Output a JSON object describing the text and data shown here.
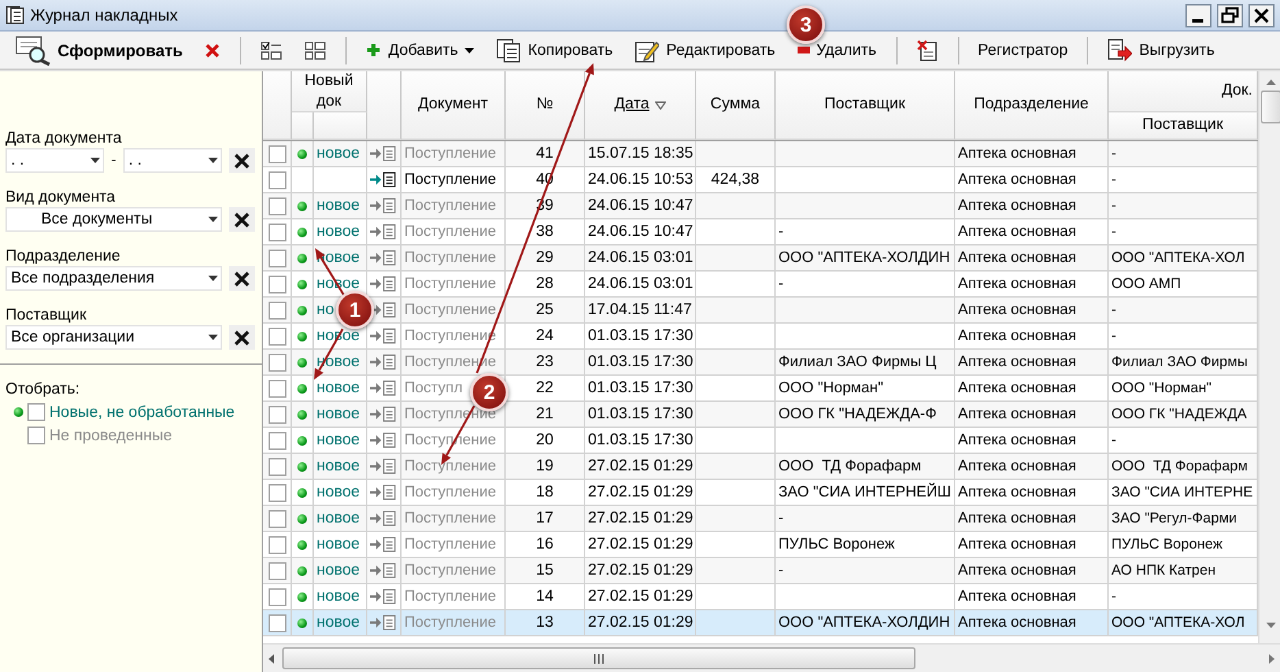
{
  "window": {
    "title": "Журнал накладных"
  },
  "toolbar": [
    {
      "kind": "primary",
      "label": "Сформировать"
    },
    {
      "kind": "icon"
    },
    {
      "kind": "separator"
    },
    {
      "kind": "icon"
    },
    {
      "kind": "icon"
    },
    {
      "kind": "separator"
    },
    {
      "kind": "menu",
      "label": "Добавить"
    },
    {
      "kind": "button",
      "label": "Копировать"
    },
    {
      "kind": "button",
      "label": "Редактировать"
    },
    {
      "kind": "button",
      "label": "Удалить"
    },
    {
      "kind": "separator"
    },
    {
      "kind": "icon"
    },
    {
      "kind": "separator"
    },
    {
      "kind": "button",
      "label": "Регистратор"
    },
    {
      "kind": "separator"
    },
    {
      "kind": "button",
      "label": "Выгрузить"
    }
  ],
  "sidebar": {
    "filters": [
      {
        "kind": "date_range",
        "label": "Дата документа",
        "values": [
          ". .",
          ". ."
        ],
        "separator": "-"
      },
      {
        "kind": "select",
        "label": "Вид документа",
        "value": "Все документы"
      },
      {
        "kind": "select",
        "label": "Подразделение",
        "value": "Все подразделения"
      },
      {
        "kind": "select",
        "label": "Поставщик",
        "value": "Все организации"
      }
    ],
    "show": {
      "label": "Отобрать:",
      "options": [
        {
          "kind": "new",
          "label": "Новые, не обработанные",
          "checked": false
        },
        {
          "kind": "unposted",
          "label": "Не проведенные",
          "checked": false
        }
      ]
    }
  },
  "table": {
    "columns": [
      {
        "label": "Новый док",
        "sorted": false
      },
      {
        "label": "Документ",
        "sorted": false
      },
      {
        "label": "№",
        "sorted": false
      },
      {
        "label": "Дата",
        "sorted": true
      },
      {
        "label": "Сумма",
        "sorted": false
      },
      {
        "label": "Поставщик",
        "sorted": false
      },
      {
        "label": "Подразделение",
        "sorted": false
      },
      {
        "label": "Док.",
        "sorted": false,
        "children": [
          {
            "label": "Поставщик"
          }
        ]
      }
    ],
    "rows": [
      {
        "checked": false,
        "new": true,
        "status": "новое",
        "posted": false,
        "document": "Поступление",
        "number": "41",
        "date": "15.07.15 18:35",
        "department": "Аптека основная",
        "doc_supplier": "-",
        "selected": false
      },
      {
        "checked": false,
        "new": false,
        "posted": true,
        "document": "Поступление",
        "number": "40",
        "date": "24.06.15 10:53",
        "sum": "424,38",
        "department": "Аптека основная",
        "doc_supplier": "-",
        "selected": false
      },
      {
        "checked": false,
        "new": true,
        "status": "новое",
        "posted": false,
        "document": "Поступление",
        "number": "39",
        "date": "24.06.15 10:47",
        "department": "Аптека основная",
        "doc_supplier": "-",
        "selected": false
      },
      {
        "checked": false,
        "new": true,
        "status": "новое",
        "posted": false,
        "document": "Поступление",
        "number": "38",
        "date": "24.06.15 10:47",
        "supplier": "-",
        "department": "Аптека основная",
        "doc_supplier": "-",
        "selected": false
      },
      {
        "checked": false,
        "new": true,
        "status": "новое",
        "posted": false,
        "document": "Поступление",
        "number": "29",
        "date": "24.06.15 03:01",
        "supplier": "ООО \"АПТЕКА-ХОЛДИН",
        "department": "Аптека основная",
        "doc_supplier": "ООО \"АПТЕКА-ХОЛ",
        "selected": false
      },
      {
        "checked": false,
        "new": true,
        "status": "новое",
        "posted": false,
        "document": "Поступление",
        "number": "28",
        "date": "24.06.15 03:01",
        "supplier": "-",
        "department": "Аптека основная",
        "doc_supplier": "ООО АМП",
        "selected": false
      },
      {
        "checked": false,
        "new": true,
        "status": "но",
        "posted": false,
        "document": "Поступление",
        "number": "25",
        "date": "17.04.15 11:47",
        "department": "Аптека основная",
        "doc_supplier": "-",
        "selected": false
      },
      {
        "checked": false,
        "new": true,
        "status": "новое",
        "posted": false,
        "document": "Поступление",
        "number": "24",
        "date": "01.03.15 17:30",
        "department": "Аптека основная",
        "doc_supplier": "-",
        "selected": false
      },
      {
        "checked": false,
        "new": true,
        "status": "новое",
        "posted": false,
        "document": "Поступление",
        "number": "23",
        "date": "01.03.15 17:30",
        "supplier": "Филиал ЗАО Фирмы Ц",
        "department": "Аптека основная",
        "doc_supplier": "Филиал ЗАО Фирмы",
        "selected": false
      },
      {
        "checked": false,
        "new": true,
        "status": "новое",
        "posted": false,
        "document": "Поступл",
        "number": "22",
        "date": "01.03.15 17:30",
        "supplier": "ООО \"Норман\"",
        "department": "Аптека основная",
        "doc_supplier": "ООО \"Норман\"",
        "selected": false
      },
      {
        "checked": false,
        "new": true,
        "status": "новое",
        "posted": false,
        "document": "Поступление",
        "number": "21",
        "date": "01.03.15 17:30",
        "supplier": "ООО ГК \"НАДЕЖДА-Ф",
        "department": "Аптека основная",
        "doc_supplier": "ООО ГК \"НАДЕЖДА",
        "selected": false
      },
      {
        "checked": false,
        "new": true,
        "status": "новое",
        "posted": false,
        "document": "Поступление",
        "number": "20",
        "date": "01.03.15 17:30",
        "department": "Аптека основная",
        "doc_supplier": "-",
        "selected": false
      },
      {
        "checked": false,
        "new": true,
        "status": "новое",
        "posted": false,
        "document": "Поступление",
        "number": "19",
        "date": "27.02.15 01:29",
        "supplier": "ООО  ТД Форафарм",
        "department": "Аптека основная",
        "doc_supplier": "ООО  ТД Форафарм",
        "selected": false
      },
      {
        "checked": false,
        "new": true,
        "status": "новое",
        "posted": false,
        "document": "Поступление",
        "number": "18",
        "date": "27.02.15 01:29",
        "supplier": "ЗАО \"СИА ИНТЕРНЕЙШ",
        "department": "Аптека основная",
        "doc_supplier": "ЗАО \"СИА ИНТЕРНЕ",
        "selected": false
      },
      {
        "checked": false,
        "new": true,
        "status": "новое",
        "posted": false,
        "document": "Поступление",
        "number": "17",
        "date": "27.02.15 01:29",
        "supplier": "-",
        "department": "Аптека основная",
        "doc_supplier": "ЗАО \"Регул-Фарми",
        "selected": false
      },
      {
        "checked": false,
        "new": true,
        "status": "новое",
        "posted": false,
        "document": "Поступление",
        "number": "16",
        "date": "27.02.15 01:29",
        "supplier": "ПУЛЬС Воронеж",
        "department": "Аптека основная",
        "doc_supplier": "ПУЛЬС Воронеж",
        "selected": false
      },
      {
        "checked": false,
        "new": true,
        "status": "новое",
        "posted": false,
        "document": "Поступление",
        "number": "15",
        "date": "27.02.15 01:29",
        "supplier": "-",
        "department": "Аптека основная",
        "doc_supplier": "АО НПК Катрен",
        "selected": false
      },
      {
        "checked": false,
        "new": true,
        "status": "новое",
        "posted": false,
        "document": "Поступление",
        "number": "14",
        "date": "27.02.15 01:29",
        "department": "Аптека основная",
        "doc_supplier": "-",
        "selected": false
      },
      {
        "checked": false,
        "new": true,
        "status": "новое",
        "posted": false,
        "document": "Поступление",
        "number": "13",
        "date": "27.02.15 01:29",
        "supplier": "ООО \"АПТЕКА-ХОЛДИН",
        "department": "Аптека основная",
        "doc_supplier": "ООО \"АПТЕКА-ХОЛ",
        "selected": true
      }
    ]
  },
  "annotations": [
    {
      "text": "1"
    },
    {
      "text": "2"
    },
    {
      "text": "3"
    }
  ]
}
